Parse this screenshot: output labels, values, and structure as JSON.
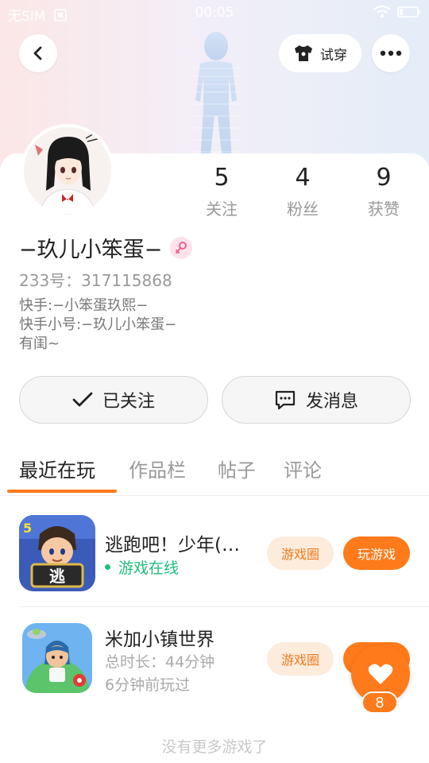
{
  "status_bar": {
    "carrier": "无SIM",
    "time": "00:05"
  },
  "header": {
    "try_on_label": "试穿"
  },
  "profile": {
    "nickname": "−玖儿小笨蛋−",
    "uid": "233号：317115868",
    "bio": [
      "快手:−小笨蛋玖熙−",
      "快手小号:−玖儿小笨蛋−",
      "有闺~"
    ],
    "stats": [
      {
        "value": "5",
        "label": "关注"
      },
      {
        "value": "4",
        "label": "粉丝"
      },
      {
        "value": "9",
        "label": "获赞"
      }
    ],
    "gender_color": "#f06292"
  },
  "actions": {
    "follow_label": "已关注",
    "message_label": "发消息"
  },
  "tabs": [
    {
      "label": "最近在玩",
      "active": true
    },
    {
      "label": "作品栏",
      "active": false
    },
    {
      "label": "帖子",
      "active": false
    },
    {
      "label": "评论",
      "active": false
    }
  ],
  "games": [
    {
      "title": "逃跑吧！少年(…",
      "status": "游戏在线",
      "circle_label": "游戏圈",
      "play_label": "玩游戏",
      "icon": "escape-game-icon"
    },
    {
      "title": "米加小镇世界",
      "duration": "总时长：44分钟",
      "last_played": "6分钟前玩过",
      "circle_label": "游戏圈",
      "play_label": "",
      "icon": "miga-town-icon"
    }
  ],
  "floating": {
    "like_count": "8"
  },
  "footer": {
    "no_more_text": "没有更多游戏了"
  },
  "colors": {
    "accent": "#ff7a1a",
    "online": "#1fbf7a",
    "pill_bg": "#fdebdc"
  }
}
